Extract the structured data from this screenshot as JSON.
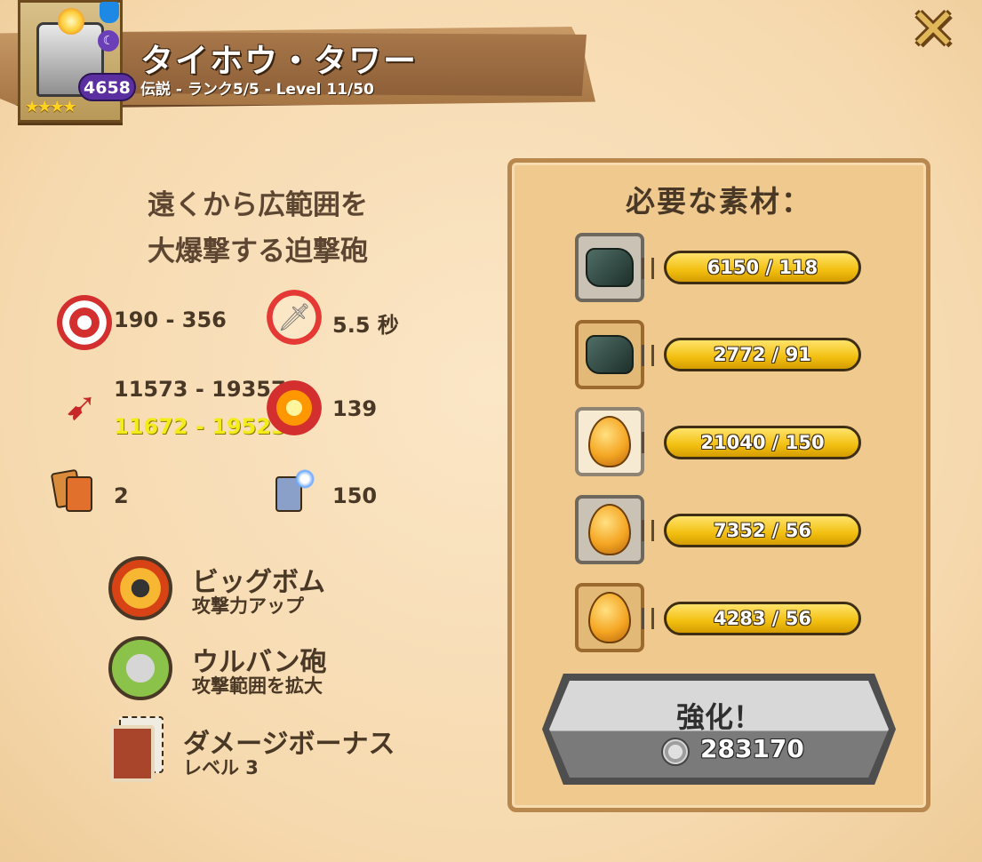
{
  "header": {
    "title": "タイホウ・タワー",
    "subtitle": "伝説 - ランク5/5 - Level 11/50",
    "power": "4658",
    "stars": "★★★★",
    "close_icon": "close-x-icon"
  },
  "description": {
    "line1": "遠くから広範囲を",
    "line2": "大爆撃する迫撃砲"
  },
  "stats": {
    "damage": "190 - 356",
    "cooldown": "5.5 秒",
    "range_base": "11573 - 19357",
    "range_boosted": "11672 - 19523",
    "explosion": "139",
    "cards": "2",
    "card_power": "150"
  },
  "skills": [
    {
      "name": "ビッグボム",
      "desc": "攻撃力アップ"
    },
    {
      "name": "ウルバン砲",
      "desc": "攻撃範囲を拡大"
    },
    {
      "name": "ダメージボーナス",
      "desc": "レベル 3"
    }
  ],
  "materials": {
    "title": "必要な素材：",
    "items": [
      {
        "count": "6150 / 118",
        "type": "stone",
        "slot": "gray"
      },
      {
        "count": "2772 / 91",
        "type": "stone",
        "slot": "tan"
      },
      {
        "count": "21040 / 150",
        "type": "egg",
        "slot": "cream"
      },
      {
        "count": "7352 / 56",
        "type": "egg",
        "slot": "gray"
      },
      {
        "count": "4283 / 56",
        "type": "egg",
        "slot": "tan"
      }
    ]
  },
  "upgrade": {
    "label": "強化！",
    "cost": "283170"
  },
  "colors": {
    "background": "#f6dcb3",
    "bar_yellow": "#f2bf10",
    "boosted_text": "#f4ec1a",
    "power_badge": "#5b2fa0"
  }
}
